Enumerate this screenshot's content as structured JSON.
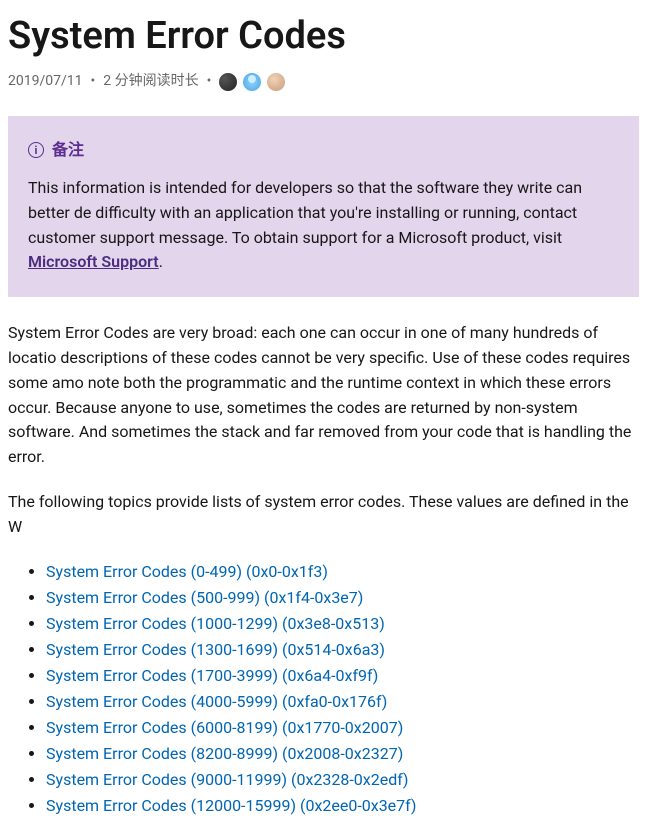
{
  "title": "System Error Codes",
  "meta": {
    "date": "2019/07/11",
    "readtime": "2 分钟阅读时长"
  },
  "note": {
    "label": "备注",
    "body_pre": "This information is intended for developers so that the software they write can better de",
    "body_mid": "difficulty with an application that you're installing or running, contact customer support",
    "body_post_pre": "message. To obtain support for a Microsoft product, visit ",
    "link_text": "Microsoft Support",
    "body_post_post": "."
  },
  "para1": "System Error Codes are very broad: each one can occur in one of many hundreds of locatio descriptions of these codes cannot be very specific. Use of these codes requires some amo note both the programmatic and the runtime context in which these errors occur. Because anyone to use, sometimes the codes are returned by non-system software. And sometimes the stack and far removed from your code that is handling the error.",
  "para2": "The following topics provide lists of system error codes. These values are defined in the W",
  "links": [
    "System Error Codes (0-499) (0x0-0x1f3)",
    "System Error Codes (500-999) (0x1f4-0x3e7)",
    "System Error Codes (1000-1299) (0x3e8-0x513)",
    "System Error Codes (1300-1699) (0x514-0x6a3)",
    "System Error Codes (1700-3999) (0x6a4-0xf9f)",
    "System Error Codes (4000-5999) (0xfa0-0x176f)",
    "System Error Codes (6000-8199) (0x1770-0x2007)",
    "System Error Codes (8200-8999) (0x2008-0x2327)",
    "System Error Codes (9000-11999) (0x2328-0x2edf)",
    "System Error Codes (12000-15999) (0x2ee0-0x3e7f)"
  ]
}
